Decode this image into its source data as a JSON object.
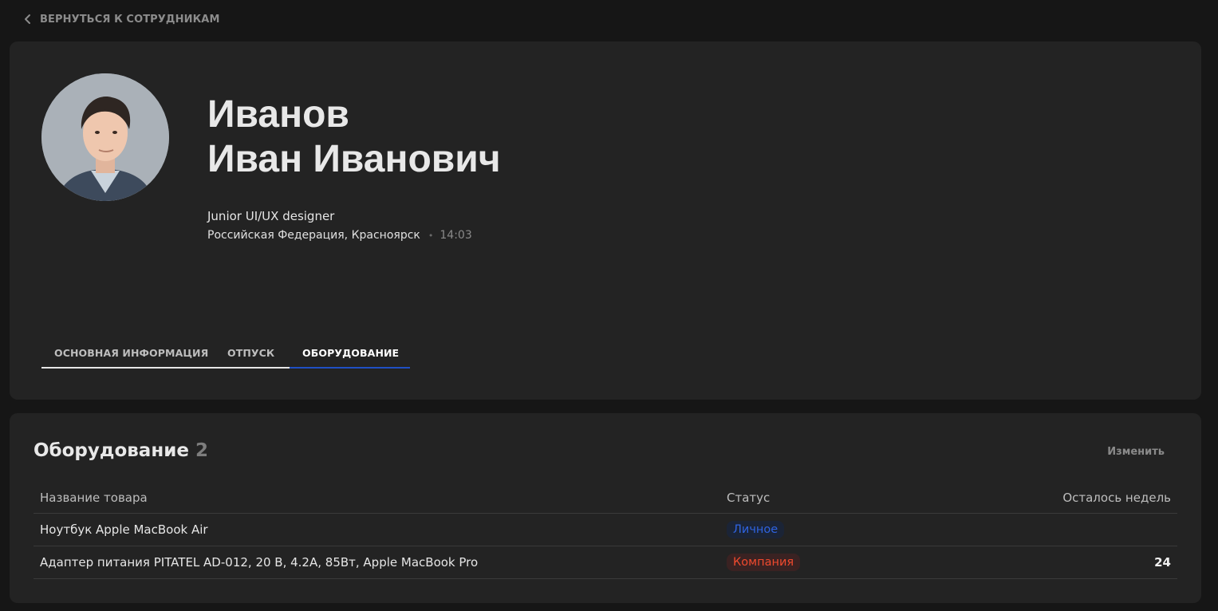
{
  "back_link": {
    "label": "ВЕРНУТЬСЯ К СОТРУДНИКАМ",
    "icon": "chevron-left-icon"
  },
  "profile": {
    "last_name": "Иванов",
    "first_middle_name": "Иван Иванович",
    "position": "Junior UI/UX designer",
    "location": "Российская Федерация, Красноярск",
    "separator": "•",
    "local_time": "14:03"
  },
  "tabs": [
    {
      "label": "ОСНОВНАЯ ИНФОРМАЦИЯ",
      "active": false
    },
    {
      "label": "ОТПУСК",
      "active": false
    },
    {
      "label": "ОБОРУДОВАНИЕ",
      "active": true
    }
  ],
  "equipment": {
    "title": "Оборудование",
    "count": "2",
    "edit_label": "Изменить",
    "columns": [
      "Название товара",
      "Статус",
      "Осталось недель"
    ],
    "rows": [
      {
        "name": "Ноутбук Apple MacBook Air",
        "status": "Личное",
        "weeks": ""
      },
      {
        "name": "Адаптер питания PITATEL AD-012, 20 В, 4.2А, 85Вт, Apple MacBook Pro",
        "status": "Компания",
        "weeks": "24"
      }
    ]
  },
  "colors": {
    "background": "#161616",
    "card": "#232323",
    "accent": "#1f4fc4",
    "status_personal": "#2f63e0",
    "status_company": "#f04a2e"
  }
}
